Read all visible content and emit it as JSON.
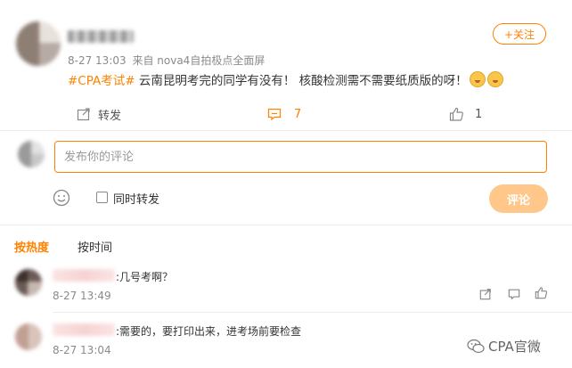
{
  "post": {
    "meta_time": "8-27 13:03",
    "meta_source": "来自 nova4自拍极点全面屏",
    "follow_label": "+关注",
    "hashtag": "#CPA考试#",
    "text": " 云南昆明考完的同学有没有！ 核酸检测需不需要纸质版的呀！",
    "actions": {
      "repost_label": "转发",
      "comment_count": "7",
      "like_count": "1"
    }
  },
  "composer": {
    "placeholder": "发布你的评论",
    "repost_label": "同时转发",
    "submit_label": "评论"
  },
  "sort_tabs": {
    "hot": "按热度",
    "time": "按时间"
  },
  "comments": [
    {
      "text": ":几号考啊？",
      "time": "8-27 13:49"
    },
    {
      "text": ":需要的，要打印出来，进考场前要检查",
      "time": "8-27 13:04"
    }
  ],
  "watermark": "CPA官微",
  "colors": {
    "accent": "#ff8200",
    "submit_disabled": "#ffc88a"
  }
}
